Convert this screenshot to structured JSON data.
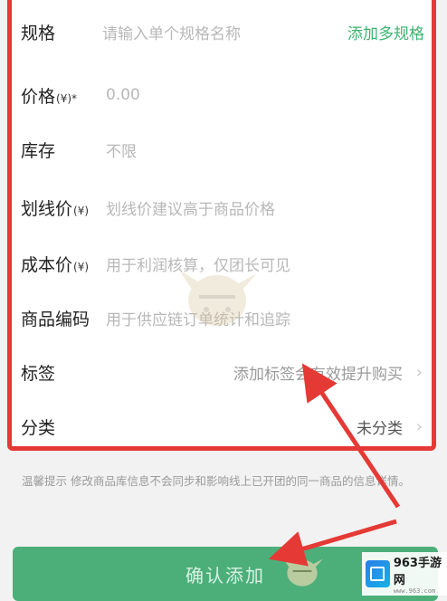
{
  "form": {
    "spec": {
      "label": "规格",
      "placeholder": "请输入单个规格名称",
      "action": "添加多规格"
    },
    "price": {
      "label": "价格",
      "unit": "(¥)",
      "required": "*",
      "placeholder": "0.00"
    },
    "stock": {
      "label": "库存",
      "value": "不限"
    },
    "list_price": {
      "label": "划线价",
      "unit": "(¥)",
      "placeholder": "划线价建议高于商品价格"
    },
    "cost_price": {
      "label": "成本价",
      "unit": "(¥)",
      "placeholder": "用于利润核算，仅团长可见"
    },
    "sku_code": {
      "label": "商品编码",
      "placeholder": "用于供应链订单统计和追踪"
    },
    "tags": {
      "label": "标签",
      "value": "添加标签会有效提升购买"
    },
    "category": {
      "label": "分类",
      "value": "未分类"
    }
  },
  "tip": "温馨提示   修改商品库信息不会同步和影响线上已开团的同一商品的信息详情。",
  "confirm_label": "确认添加",
  "watermark": {
    "brand": "963手游网",
    "url": "www.963.com"
  },
  "colors": {
    "accent": "#3cb371",
    "highlight": "#e53935",
    "button": "#4caf7a"
  },
  "icons": [
    "chevron-right-icon",
    "red-arrow-icon",
    "mascot-watermark-icon",
    "site-logo-icon"
  ]
}
